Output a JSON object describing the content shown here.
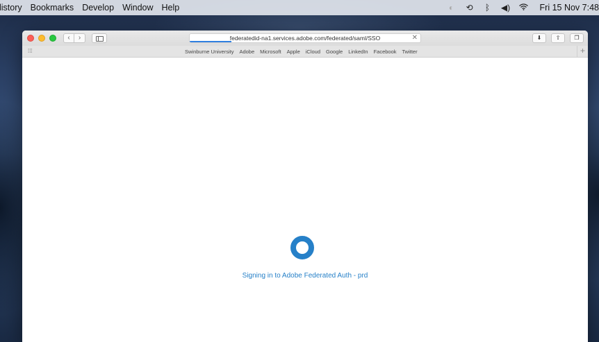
{
  "menubar": {
    "items": [
      "listory",
      "Bookmarks",
      "Develop",
      "Window",
      "Help"
    ],
    "clock": "Fri 15 Nov 7:48"
  },
  "status_icons": [
    "theme-icon",
    "time-machine-icon",
    "bluetooth-icon",
    "volume-icon",
    "wifi-icon"
  ],
  "browser": {
    "url": "federatedid-na1.services.adobe.com/federated/saml/SSO",
    "load_progress_percent": 18,
    "bookmarks": [
      "Swinburne University",
      "Adobe",
      "Microsoft",
      "Apple",
      "iCloud",
      "Google",
      "LinkedIn",
      "Facebook",
      "Twitter"
    ]
  },
  "page": {
    "status_text": "Signing in to Adobe Federated Auth - prd",
    "accent_color": "#2680c8"
  }
}
